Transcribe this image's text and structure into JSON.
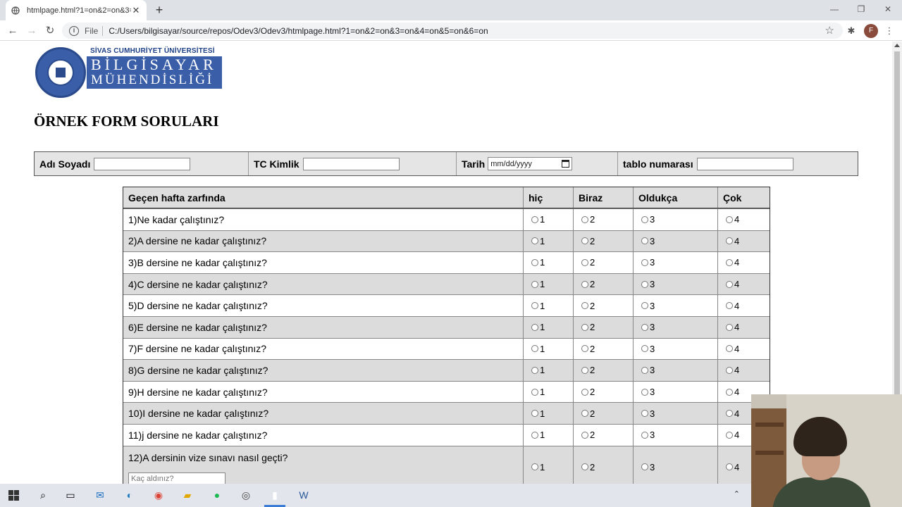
{
  "browser": {
    "tab_title": "htmlpage.html?1=on&2=on&3=on&4=on&5=on&6=on",
    "url_scheme": "File",
    "url": "C:/Users/bilgisayar/source/repos/Odev3/Odev3/htmlpage.html?1=on&2=on&3=on&4=on&5=on&6=on",
    "profile_initial": "F"
  },
  "logo": {
    "line1": "SİVAS CUMHURİYET ÜNİVERSİTESİ",
    "line2": "BİLGİSAYAR",
    "line3": "MÜHENDİSLİĞİ"
  },
  "page": {
    "title": "ÖRNEK FORM SORULARI"
  },
  "info": {
    "name_label": "Adı Soyadı",
    "name_value": "",
    "tc_label": "TC Kimlik",
    "tc_value": "",
    "date_label": "Tarih",
    "date_placeholder": "mm/dd/yyyy",
    "table_label": "tablo numarası",
    "table_value": ""
  },
  "survey": {
    "headers": [
      "Geçen hafta zarfında",
      "hiç",
      "Biraz",
      "Oldukça",
      "Çok"
    ],
    "option_values": [
      "1",
      "2",
      "3",
      "4"
    ],
    "questions": [
      "1)Ne kadar çalıştınız?",
      "2)A dersine ne kadar çalıştınız?",
      "3)B dersine ne kadar çalıştınız?",
      "4)C dersine ne kadar çalıştınız?",
      "5)D dersine ne kadar çalıştınız?",
      "6)E dersine ne kadar çalıştınız?",
      "7)F dersine ne kadar çalıştınız?",
      "8)G dersine ne kadar çalıştınız?",
      "9)H dersine ne kadar çalıştınız?",
      "10)I dersine ne kadar çalıştınız?",
      "11)j dersine ne kadar çalıştınız?",
      "12)A dersinin vize sınavı nasıl geçti?"
    ],
    "q12_input_placeholder": "Kaç aldınız?"
  }
}
